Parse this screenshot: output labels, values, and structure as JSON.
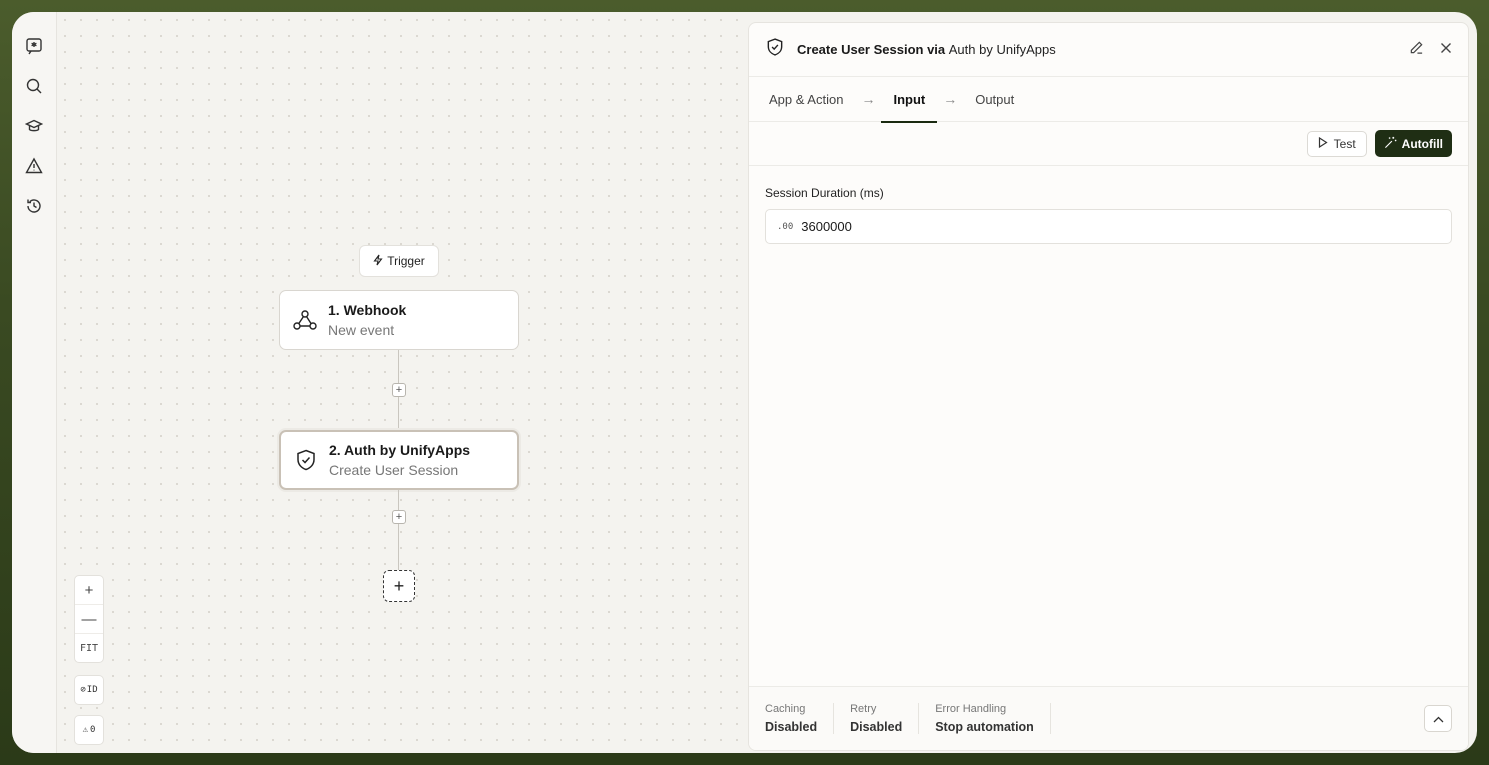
{
  "canvas": {
    "trigger_label": "Trigger",
    "nodes": [
      {
        "title": "1. Webhook",
        "subtitle": "New event"
      },
      {
        "title": "2. Auth by UnifyApps",
        "subtitle": "Create User Session"
      }
    ],
    "add_step": "+",
    "zoom": {
      "in": "+",
      "out": "—",
      "fit": "FIT"
    },
    "id_toggle": "ID",
    "warnings_count": "0"
  },
  "panel": {
    "title_action": "Create User Session via",
    "title_app": "Auth by UnifyApps",
    "tabs": [
      {
        "label": "App & Action"
      },
      {
        "label": "Input"
      },
      {
        "label": "Output"
      }
    ],
    "active_tab": "Input",
    "test_label": "Test",
    "autofill_label": "Autofill",
    "field": {
      "label": "Session Duration (ms)",
      "type_badge": ".00",
      "value": "3600000"
    },
    "footer": [
      {
        "key": "Caching",
        "value": "Disabled"
      },
      {
        "key": "Retry",
        "value": "Disabled"
      },
      {
        "key": "Error Handling",
        "value": "Stop automation"
      }
    ]
  },
  "rail": {
    "icons": [
      "sparkle-chat-icon",
      "search-icon",
      "graduation-cap-icon",
      "warning-icon",
      "history-icon"
    ]
  },
  "colors": {
    "accent": "#1f2e14",
    "frame_bg": "#4b5c2c"
  }
}
